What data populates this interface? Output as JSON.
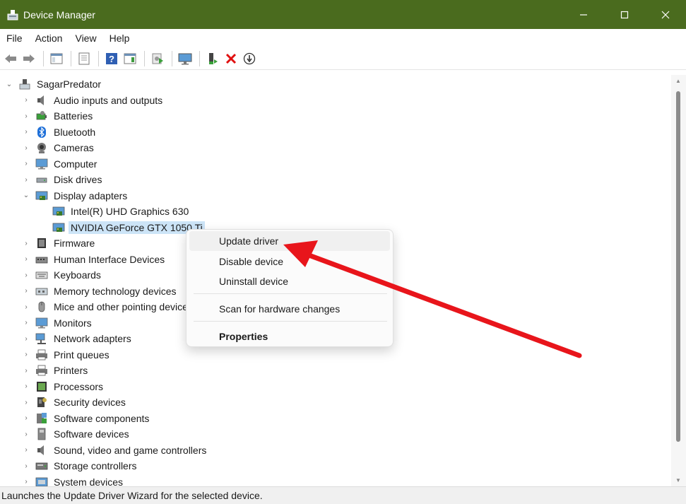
{
  "window": {
    "title": "Device Manager",
    "accent": "#4a6b1e"
  },
  "menu": [
    "File",
    "Action",
    "View",
    "Help"
  ],
  "tree": {
    "root": "SagarPredator",
    "items": [
      {
        "label": "Audio inputs and outputs",
        "icon": "speaker-icon"
      },
      {
        "label": "Batteries",
        "icon": "battery-icon"
      },
      {
        "label": "Bluetooth",
        "icon": "bluetooth-icon"
      },
      {
        "label": "Cameras",
        "icon": "camera-icon"
      },
      {
        "label": "Computer",
        "icon": "monitor-icon"
      },
      {
        "label": "Disk drives",
        "icon": "disk-icon"
      },
      {
        "label": "Display adapters",
        "icon": "display-adapter-icon",
        "expanded": true
      },
      {
        "label": "Intel(R) UHD Graphics 630",
        "icon": "display-adapter-icon",
        "child": true
      },
      {
        "label": "NVIDIA GeForce GTX 1050 Ti",
        "icon": "display-adapter-icon",
        "child": true,
        "selected": true
      },
      {
        "label": "Firmware",
        "icon": "chip-icon"
      },
      {
        "label": "Human Interface Devices",
        "icon": "hid-icon"
      },
      {
        "label": "Keyboards",
        "icon": "keyboard-icon"
      },
      {
        "label": "Memory technology devices",
        "icon": "memory-icon"
      },
      {
        "label": "Mice and other pointing devices",
        "icon": "mouse-icon"
      },
      {
        "label": "Monitors",
        "icon": "monitor-icon"
      },
      {
        "label": "Network adapters",
        "icon": "network-icon"
      },
      {
        "label": "Print queues",
        "icon": "printer-icon"
      },
      {
        "label": "Printers",
        "icon": "printer-icon"
      },
      {
        "label": "Processors",
        "icon": "processor-icon"
      },
      {
        "label": "Security devices",
        "icon": "security-icon"
      },
      {
        "label": "Software components",
        "icon": "software-component-icon"
      },
      {
        "label": "Software devices",
        "icon": "software-device-icon"
      },
      {
        "label": "Sound, video and game controllers",
        "icon": "speaker-icon"
      },
      {
        "label": "Storage controllers",
        "icon": "storage-icon"
      },
      {
        "label": "System devices",
        "icon": "system-icon"
      }
    ]
  },
  "context_menu": {
    "update_driver": "Update driver",
    "disable_device": "Disable device",
    "uninstall_device": "Uninstall device",
    "scan": "Scan for hardware changes",
    "properties": "Properties"
  },
  "status": "Launches the Update Driver Wizard for the selected device.",
  "annotation_color": "#e8151b"
}
